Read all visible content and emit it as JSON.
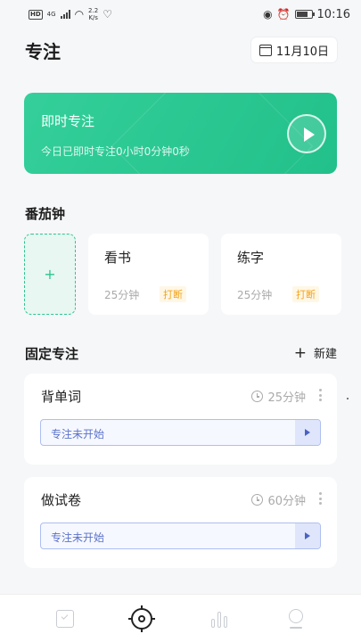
{
  "status_bar": {
    "network": "4G",
    "speed_value": "2.2",
    "speed_unit": "K/s",
    "time": "10:16"
  },
  "header": {
    "title": "专注",
    "date": "11月10日"
  },
  "instant_focus": {
    "title": "即时专注",
    "summary": "今日已即时专注0小时0分钟0秒"
  },
  "pomodoro": {
    "title": "番茄钟",
    "add_label": "+",
    "cards": [
      {
        "name": "看书",
        "duration": "25分钟",
        "tag": "打断"
      },
      {
        "name": "练字",
        "duration": "25分钟",
        "tag": "打断"
      }
    ]
  },
  "fixed_focus": {
    "title": "固定专注",
    "new_label": "新建",
    "tasks": [
      {
        "name": "背单词",
        "duration": "25分钟",
        "status": "专注未开始"
      },
      {
        "name": "做试卷",
        "duration": "60分钟",
        "status": "专注未开始"
      }
    ]
  },
  "colors": {
    "accent_green": "#2dc591",
    "interrupt_tag": "#f2a41c",
    "status_blue": "#5b72c9"
  },
  "icons": {
    "nav": [
      "todo-icon",
      "focus-icon",
      "stats-icon",
      "profile-icon"
    ]
  }
}
